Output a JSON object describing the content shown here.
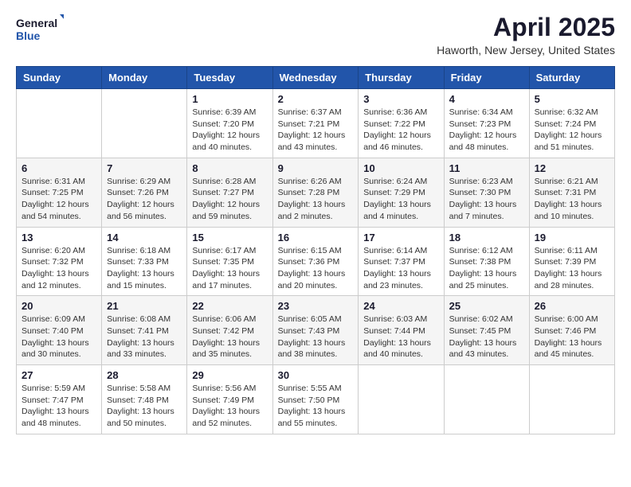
{
  "header": {
    "logo_general": "General",
    "logo_blue": "Blue",
    "month": "April 2025",
    "location": "Haworth, New Jersey, United States"
  },
  "days_of_week": [
    "Sunday",
    "Monday",
    "Tuesday",
    "Wednesday",
    "Thursday",
    "Friday",
    "Saturday"
  ],
  "weeks": [
    [
      {
        "day": "",
        "info": ""
      },
      {
        "day": "",
        "info": ""
      },
      {
        "day": "1",
        "info": "Sunrise: 6:39 AM\nSunset: 7:20 PM\nDaylight: 12 hours and 40 minutes."
      },
      {
        "day": "2",
        "info": "Sunrise: 6:37 AM\nSunset: 7:21 PM\nDaylight: 12 hours and 43 minutes."
      },
      {
        "day": "3",
        "info": "Sunrise: 6:36 AM\nSunset: 7:22 PM\nDaylight: 12 hours and 46 minutes."
      },
      {
        "day": "4",
        "info": "Sunrise: 6:34 AM\nSunset: 7:23 PM\nDaylight: 12 hours and 48 minutes."
      },
      {
        "day": "5",
        "info": "Sunrise: 6:32 AM\nSunset: 7:24 PM\nDaylight: 12 hours and 51 minutes."
      }
    ],
    [
      {
        "day": "6",
        "info": "Sunrise: 6:31 AM\nSunset: 7:25 PM\nDaylight: 12 hours and 54 minutes."
      },
      {
        "day": "7",
        "info": "Sunrise: 6:29 AM\nSunset: 7:26 PM\nDaylight: 12 hours and 56 minutes."
      },
      {
        "day": "8",
        "info": "Sunrise: 6:28 AM\nSunset: 7:27 PM\nDaylight: 12 hours and 59 minutes."
      },
      {
        "day": "9",
        "info": "Sunrise: 6:26 AM\nSunset: 7:28 PM\nDaylight: 13 hours and 2 minutes."
      },
      {
        "day": "10",
        "info": "Sunrise: 6:24 AM\nSunset: 7:29 PM\nDaylight: 13 hours and 4 minutes."
      },
      {
        "day": "11",
        "info": "Sunrise: 6:23 AM\nSunset: 7:30 PM\nDaylight: 13 hours and 7 minutes."
      },
      {
        "day": "12",
        "info": "Sunrise: 6:21 AM\nSunset: 7:31 PM\nDaylight: 13 hours and 10 minutes."
      }
    ],
    [
      {
        "day": "13",
        "info": "Sunrise: 6:20 AM\nSunset: 7:32 PM\nDaylight: 13 hours and 12 minutes."
      },
      {
        "day": "14",
        "info": "Sunrise: 6:18 AM\nSunset: 7:33 PM\nDaylight: 13 hours and 15 minutes."
      },
      {
        "day": "15",
        "info": "Sunrise: 6:17 AM\nSunset: 7:35 PM\nDaylight: 13 hours and 17 minutes."
      },
      {
        "day": "16",
        "info": "Sunrise: 6:15 AM\nSunset: 7:36 PM\nDaylight: 13 hours and 20 minutes."
      },
      {
        "day": "17",
        "info": "Sunrise: 6:14 AM\nSunset: 7:37 PM\nDaylight: 13 hours and 23 minutes."
      },
      {
        "day": "18",
        "info": "Sunrise: 6:12 AM\nSunset: 7:38 PM\nDaylight: 13 hours and 25 minutes."
      },
      {
        "day": "19",
        "info": "Sunrise: 6:11 AM\nSunset: 7:39 PM\nDaylight: 13 hours and 28 minutes."
      }
    ],
    [
      {
        "day": "20",
        "info": "Sunrise: 6:09 AM\nSunset: 7:40 PM\nDaylight: 13 hours and 30 minutes."
      },
      {
        "day": "21",
        "info": "Sunrise: 6:08 AM\nSunset: 7:41 PM\nDaylight: 13 hours and 33 minutes."
      },
      {
        "day": "22",
        "info": "Sunrise: 6:06 AM\nSunset: 7:42 PM\nDaylight: 13 hours and 35 minutes."
      },
      {
        "day": "23",
        "info": "Sunrise: 6:05 AM\nSunset: 7:43 PM\nDaylight: 13 hours and 38 minutes."
      },
      {
        "day": "24",
        "info": "Sunrise: 6:03 AM\nSunset: 7:44 PM\nDaylight: 13 hours and 40 minutes."
      },
      {
        "day": "25",
        "info": "Sunrise: 6:02 AM\nSunset: 7:45 PM\nDaylight: 13 hours and 43 minutes."
      },
      {
        "day": "26",
        "info": "Sunrise: 6:00 AM\nSunset: 7:46 PM\nDaylight: 13 hours and 45 minutes."
      }
    ],
    [
      {
        "day": "27",
        "info": "Sunrise: 5:59 AM\nSunset: 7:47 PM\nDaylight: 13 hours and 48 minutes."
      },
      {
        "day": "28",
        "info": "Sunrise: 5:58 AM\nSunset: 7:48 PM\nDaylight: 13 hours and 50 minutes."
      },
      {
        "day": "29",
        "info": "Sunrise: 5:56 AM\nSunset: 7:49 PM\nDaylight: 13 hours and 52 minutes."
      },
      {
        "day": "30",
        "info": "Sunrise: 5:55 AM\nSunset: 7:50 PM\nDaylight: 13 hours and 55 minutes."
      },
      {
        "day": "",
        "info": ""
      },
      {
        "day": "",
        "info": ""
      },
      {
        "day": "",
        "info": ""
      }
    ]
  ]
}
